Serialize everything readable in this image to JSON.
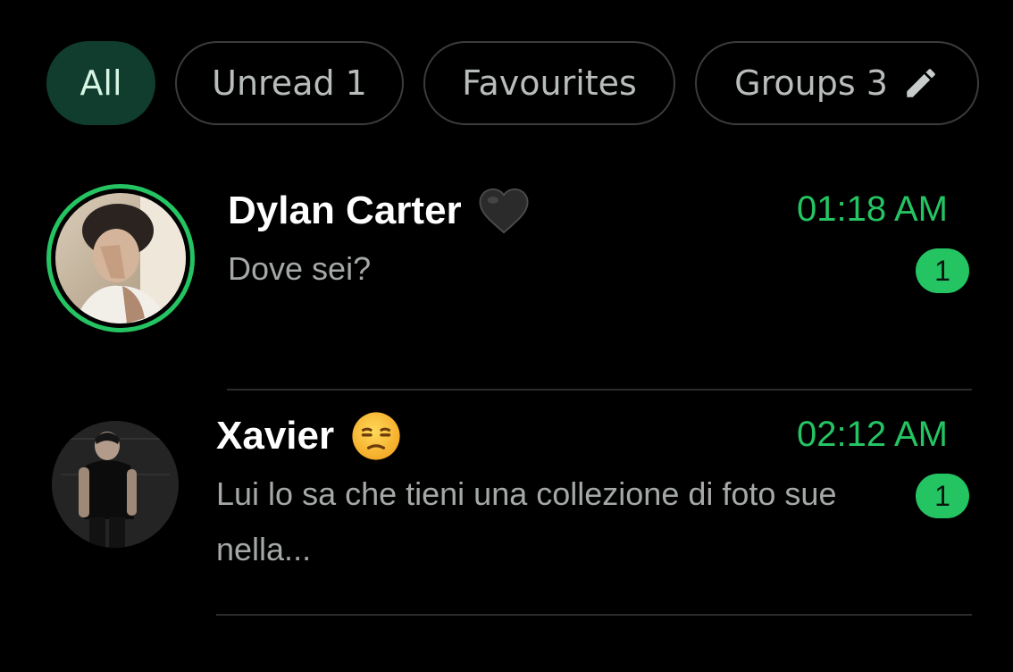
{
  "filters": [
    {
      "label": "All",
      "active": true
    },
    {
      "label": "Unread 1",
      "active": false
    },
    {
      "label": "Favourites",
      "active": false
    },
    {
      "label": "Groups 3",
      "active": false,
      "icon": "pencil-icon"
    }
  ],
  "chats": [
    {
      "name": "Dylan Carter",
      "emoji": "black-heart-icon",
      "time": "01:18 AM",
      "preview": "Dove sei?",
      "unread": "1",
      "status_ring": true
    },
    {
      "name": "Xavier",
      "emoji": "unamused-face-icon",
      "time": "02:12 AM",
      "preview": "Lui lo sa che tieni una collezione di foto sue nella...",
      "unread": "1",
      "status_ring": false
    }
  ],
  "colors": {
    "accent": "#25c463",
    "chip_active_bg": "#103d2e",
    "background": "#000000"
  }
}
